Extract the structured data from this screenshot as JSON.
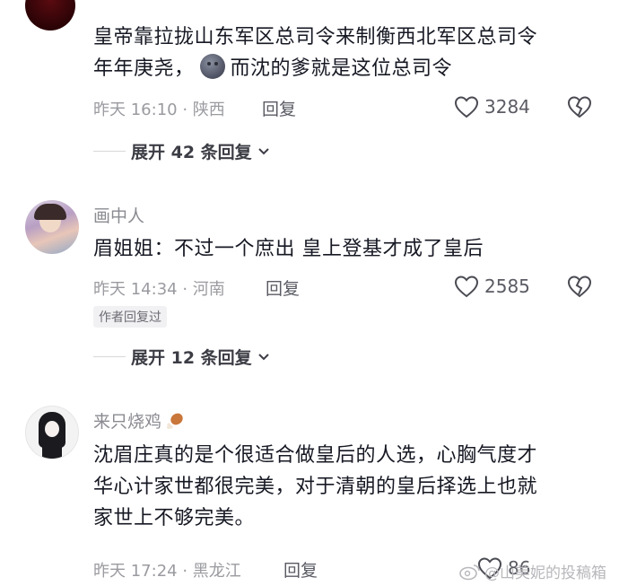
{
  "comments": [
    {
      "text_line1": "皇帝靠拉拢山东军区总司令来制衡西北军区总司令",
      "text_line2a": "年年庚尧，",
      "text_line2b": "而沈的爹就是这位总司令",
      "time_location": "昨天 16:10 · 陕西",
      "reply_label": "回复",
      "likes": "3284",
      "expand_label": "展开 42 条回复"
    },
    {
      "username": "画中人",
      "text_line1": "眉姐姐：不过一个庶出 皇上登基才成了皇后",
      "time_location": "昨天 14:34 · 河南",
      "reply_label": "回复",
      "likes": "2585",
      "author_badge": "作者回复过",
      "expand_label": "展开 12 条回复"
    },
    {
      "username": "来只烧鸡",
      "text_line1": "沈眉庄真的是个很适合做皇后的人选，心胸气度才",
      "text_line2": "华心计家世都很完美，对于清朝的皇后择选上也就",
      "text_line3": "家世上不够完美。",
      "time_location": "昨天 17:24 · 黑龙江",
      "reply_label": "回复",
      "likes": "86"
    }
  ],
  "watermark": "@山美妮的投稿箱"
}
